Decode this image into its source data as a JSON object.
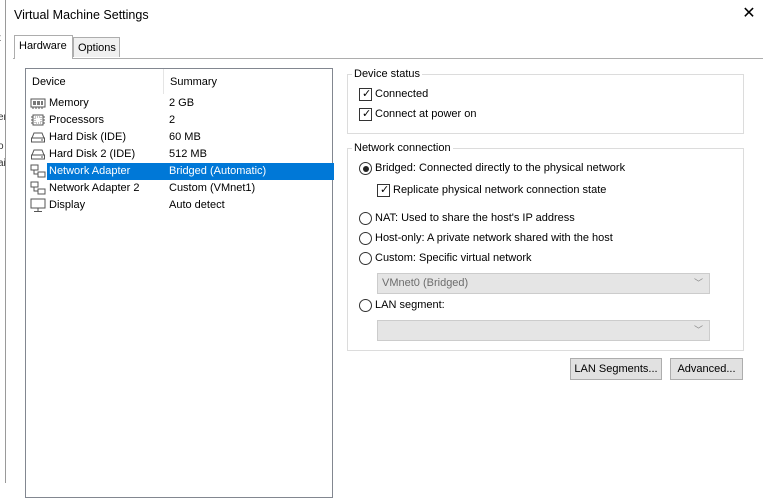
{
  "window": {
    "title": "Virtual Machine Settings"
  },
  "tabs": [
    {
      "label": "Hardware",
      "active": true
    },
    {
      "label": "Options",
      "active": false
    }
  ],
  "device_list": {
    "columns": [
      "Device",
      "Summary"
    ],
    "rows": [
      {
        "device": "Memory",
        "summary": "2 GB",
        "icon": "memory-icon"
      },
      {
        "device": "Processors",
        "summary": "2",
        "icon": "processor-icon"
      },
      {
        "device": "Hard Disk (IDE)",
        "summary": "60 MB",
        "icon": "hard-disk-icon"
      },
      {
        "device": "Hard Disk 2 (IDE)",
        "summary": "512 MB",
        "icon": "hard-disk-icon"
      },
      {
        "device": "Network Adapter",
        "summary": "Bridged (Automatic)",
        "icon": "network-adapter-icon",
        "selected": true
      },
      {
        "device": "Network Adapter 2",
        "summary": "Custom (VMnet1)",
        "icon": "network-adapter-icon"
      },
      {
        "device": "Display",
        "summary": "Auto detect",
        "icon": "display-icon"
      }
    ]
  },
  "device_status": {
    "label": "Device status",
    "connected": {
      "label": "Connected",
      "checked": true
    },
    "connect_at_power_on": {
      "label": "Connect at power on",
      "checked": true
    }
  },
  "network_connection": {
    "label": "Network connection",
    "bridged": {
      "label": "Bridged: Connected directly to the physical network",
      "selected": true
    },
    "replicate": {
      "label": "Replicate physical network connection state",
      "checked": true
    },
    "nat": {
      "label": "NAT: Used to share the host's IP address",
      "selected": false
    },
    "host_only": {
      "label": "Host-only: A private network shared with the host",
      "selected": false
    },
    "custom": {
      "label": "Custom: Specific virtual network",
      "selected": false
    },
    "custom_select": {
      "value": "VMnet0 (Bridged)",
      "enabled": false
    },
    "lan_segment": {
      "label": "LAN segment:",
      "selected": false
    },
    "lan_select": {
      "value": "",
      "enabled": false
    }
  },
  "buttons": {
    "lan_segments": "LAN Segments...",
    "advanced": "Advanced..."
  },
  "background_text": [
    "t",
    "er",
    "o",
    "ai"
  ],
  "colors": {
    "selection": "#0078d7"
  }
}
